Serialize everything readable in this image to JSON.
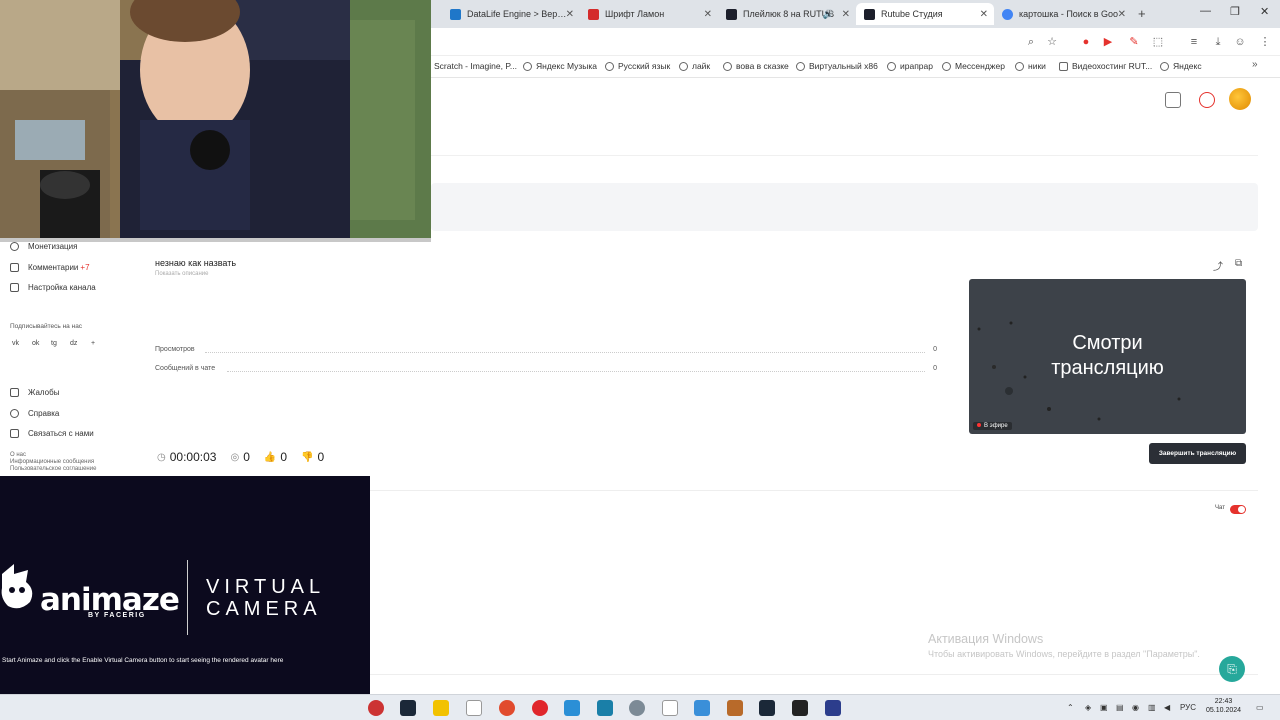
{
  "browser": {
    "tabs": [
      {
        "label": "DataLife Engine > Версия",
        "icon_color": "#1f77c9"
      },
      {
        "label": "Шрифт Ламон",
        "icon_color": "#d42b2b"
      },
      {
        "label": "Плейлюк 8 на RUTUB",
        "icon_color": "#1c1f2b"
      },
      {
        "label": "Rutube Студия",
        "icon_color": "#1c1f2b"
      },
      {
        "label": "картошка - Поиск в Goo",
        "icon_color": "#4285f4"
      }
    ],
    "bookmarks": [
      "Scratch - Imagine, P...",
      "Яндекс Музыка",
      "Русский язык",
      "лайк",
      "вова в сказке",
      "Виртуальный x86",
      "ирапрар",
      "Мессенджер",
      "ники",
      "Видеохостинг RUT...",
      "Яндекс"
    ]
  },
  "sidebar": {
    "items": [
      {
        "label": "Монетизация",
        "badge": ""
      },
      {
        "label": "Комментарии",
        "badge": "+7"
      },
      {
        "label": "Настройка канала",
        "badge": ""
      }
    ],
    "subscribe_label": "Подписывайтесь на нас",
    "socials": [
      "vk",
      "ok",
      "tg",
      "dz",
      "+"
    ],
    "help_items": [
      {
        "label": "Жалобы"
      },
      {
        "label": "Справка"
      },
      {
        "label": "Связаться с нами"
      }
    ],
    "footer_links": [
      "О нас",
      "Информационные сообщения",
      "Пользовательское соглашение"
    ]
  },
  "stream": {
    "title": "незнаю как назвать",
    "show_description": "Показать описание",
    "stats": [
      {
        "label": "Просмотров",
        "value": "0"
      },
      {
        "label": "Сообщений в чате",
        "value": "0"
      }
    ],
    "duration": "00:00:03",
    "viewers": "0",
    "likes": "0",
    "dislikes": "0",
    "preview_text_line1": "Смотри",
    "preview_text_line2": "трансляцию",
    "live_label": "В эфире",
    "end_button": "Завершить трансляцию",
    "chat_label": "Чат"
  },
  "windows_activation": {
    "title": "Активация Windows",
    "subtitle": "Чтобы активировать Windows, перейдите в раздел \"Параметры\"."
  },
  "animaze": {
    "logo": "animaze",
    "by": "BY FACERIG",
    "virtual": "VIRTUAL",
    "camera": "CAMERA",
    "message": "Start Animaze and click the Enable Virtual Camera button to start seeing the rendered avatar here"
  },
  "taskbar": {
    "lang": "РУС",
    "time": "22:43",
    "date": "05.10.2024"
  }
}
